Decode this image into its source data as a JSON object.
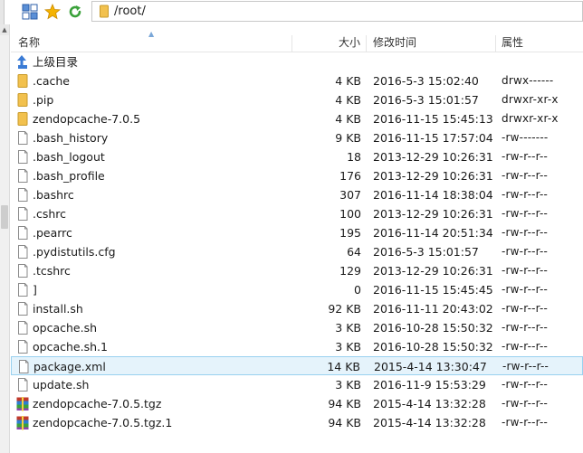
{
  "toolbar": {
    "path": "/root/"
  },
  "columns": {
    "name": "名称",
    "size": "大小",
    "modified": "修改时间",
    "attributes": "属性"
  },
  "parent_dir_label": "上级目录",
  "files": [
    {
      "name": ".cache",
      "size": "4 KB",
      "modified": "2016-5-3 15:02:40",
      "attr": "drwx------",
      "kind": "folder"
    },
    {
      "name": ".pip",
      "size": "4 KB",
      "modified": "2016-5-3 15:01:57",
      "attr": "drwxr-xr-x",
      "kind": "folder"
    },
    {
      "name": "zendopcache-7.0.5",
      "size": "4 KB",
      "modified": "2016-11-15 15:45:13",
      "attr": "drwxr-xr-x",
      "kind": "folder"
    },
    {
      "name": ".bash_history",
      "size": "9 KB",
      "modified": "2016-11-15 17:57:04",
      "attr": "-rw-------",
      "kind": "file"
    },
    {
      "name": ".bash_logout",
      "size": "18",
      "modified": "2013-12-29 10:26:31",
      "attr": "-rw-r--r--",
      "kind": "file"
    },
    {
      "name": ".bash_profile",
      "size": "176",
      "modified": "2013-12-29 10:26:31",
      "attr": "-rw-r--r--",
      "kind": "file"
    },
    {
      "name": ".bashrc",
      "size": "307",
      "modified": "2016-11-14 18:38:04",
      "attr": "-rw-r--r--",
      "kind": "file"
    },
    {
      "name": ".cshrc",
      "size": "100",
      "modified": "2013-12-29 10:26:31",
      "attr": "-rw-r--r--",
      "kind": "file"
    },
    {
      "name": ".pearrc",
      "size": "195",
      "modified": "2016-11-14 20:51:34",
      "attr": "-rw-r--r--",
      "kind": "file"
    },
    {
      "name": ".pydistutils.cfg",
      "size": "64",
      "modified": "2016-5-3 15:01:57",
      "attr": "-rw-r--r--",
      "kind": "file"
    },
    {
      "name": ".tcshrc",
      "size": "129",
      "modified": "2013-12-29 10:26:31",
      "attr": "-rw-r--r--",
      "kind": "file"
    },
    {
      "name": "]",
      "size": "0",
      "modified": "2016-11-15 15:45:45",
      "attr": "-rw-r--r--",
      "kind": "file"
    },
    {
      "name": "install.sh",
      "size": "92 KB",
      "modified": "2016-11-11 20:43:02",
      "attr": "-rw-r--r--",
      "kind": "file"
    },
    {
      "name": "opcache.sh",
      "size": "3 KB",
      "modified": "2016-10-28 15:50:32",
      "attr": "-rw-r--r--",
      "kind": "file"
    },
    {
      "name": "opcache.sh.1",
      "size": "3 KB",
      "modified": "2016-10-28 15:50:32",
      "attr": "-rw-r--r--",
      "kind": "file"
    },
    {
      "name": "package.xml",
      "size": "14 KB",
      "modified": "2015-4-14 13:30:47",
      "attr": "-rw-r--r--",
      "kind": "file",
      "selected": true
    },
    {
      "name": "update.sh",
      "size": "3 KB",
      "modified": "2016-11-9 15:53:29",
      "attr": "-rw-r--r--",
      "kind": "file"
    },
    {
      "name": "zendopcache-7.0.5.tgz",
      "size": "94 KB",
      "modified": "2015-4-14 13:32:28",
      "attr": "-rw-r--r--",
      "kind": "archive"
    },
    {
      "name": "zendopcache-7.0.5.tgz.1",
      "size": "94 KB",
      "modified": "2015-4-14 13:32:28",
      "attr": "-rw-r--r--",
      "kind": "archive"
    }
  ],
  "colors": {
    "selection_bg": "#e5f3fb",
    "selection_border": "#99d1ef",
    "folder": "#f0c040",
    "nav_up": "#3a7bd5"
  }
}
